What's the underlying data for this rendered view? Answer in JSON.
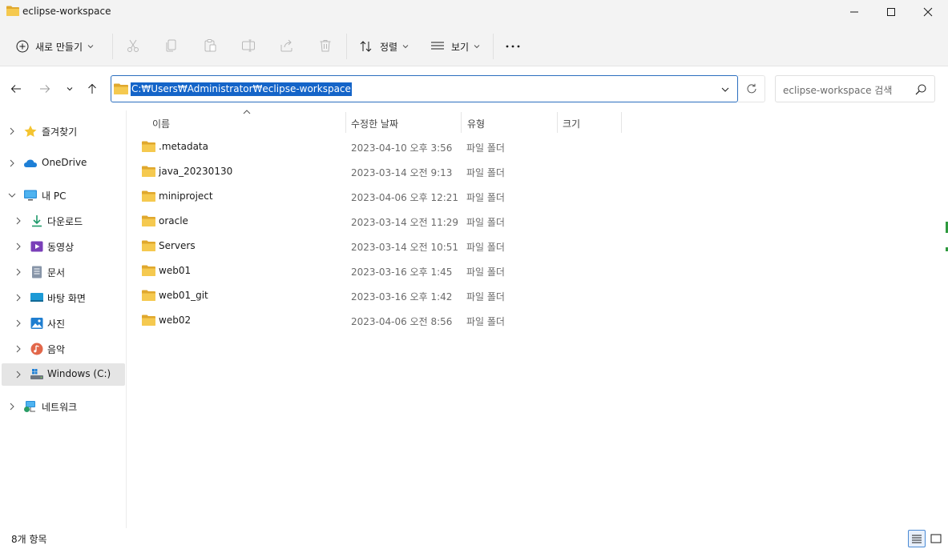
{
  "window": {
    "title": "eclipse-workspace"
  },
  "toolbar": {
    "new_label": "새로 만들기",
    "sort_label": "정렬",
    "view_label": "보기",
    "more_label": "···"
  },
  "address": {
    "path": "C:₩Users₩Administrator₩eclipse-workspace",
    "search_placeholder": "eclipse-workspace 검색"
  },
  "sidebar": {
    "items": [
      {
        "label": "즐겨찾기",
        "icon": "star-icon"
      },
      {
        "label": "OneDrive",
        "icon": "cloud-icon"
      },
      {
        "label": "내 PC",
        "icon": "monitor-icon"
      },
      {
        "label": "다운로드",
        "icon": "download-icon"
      },
      {
        "label": "동영상",
        "icon": "video-icon"
      },
      {
        "label": "문서",
        "icon": "document-icon"
      },
      {
        "label": "바탕 화면",
        "icon": "desktop-icon"
      },
      {
        "label": "사진",
        "icon": "pictures-icon"
      },
      {
        "label": "음악",
        "icon": "music-icon"
      },
      {
        "label": "Windows (C:)",
        "icon": "drive-icon"
      },
      {
        "label": "네트워크",
        "icon": "network-icon"
      }
    ]
  },
  "columns": {
    "name": "이름",
    "modified": "수정한 날짜",
    "type": "유형",
    "size": "크기"
  },
  "files": [
    {
      "name": ".metadata",
      "modified": "2023-04-10 오후 3:56",
      "type": "파일 폴더"
    },
    {
      "name": "java_20230130",
      "modified": "2023-03-14 오전 9:13",
      "type": "파일 폴더"
    },
    {
      "name": "miniproject",
      "modified": "2023-04-06 오후 12:21",
      "type": "파일 폴더"
    },
    {
      "name": "oracle",
      "modified": "2023-03-14 오전 11:29",
      "type": "파일 폴더"
    },
    {
      "name": "Servers",
      "modified": "2023-03-14 오전 10:51",
      "type": "파일 폴더"
    },
    {
      "name": "web01",
      "modified": "2023-03-16 오후 1:45",
      "type": "파일 폴더"
    },
    {
      "name": "web01_git",
      "modified": "2023-03-16 오후 1:42",
      "type": "파일 폴더"
    },
    {
      "name": "web02",
      "modified": "2023-04-06 오전 8:56",
      "type": "파일 폴더"
    }
  ],
  "status": {
    "item_count": "8개 항목"
  },
  "colors": {
    "folder": "#f2c14e",
    "folder_dark": "#e0a82e",
    "accent": "#1464c8"
  }
}
